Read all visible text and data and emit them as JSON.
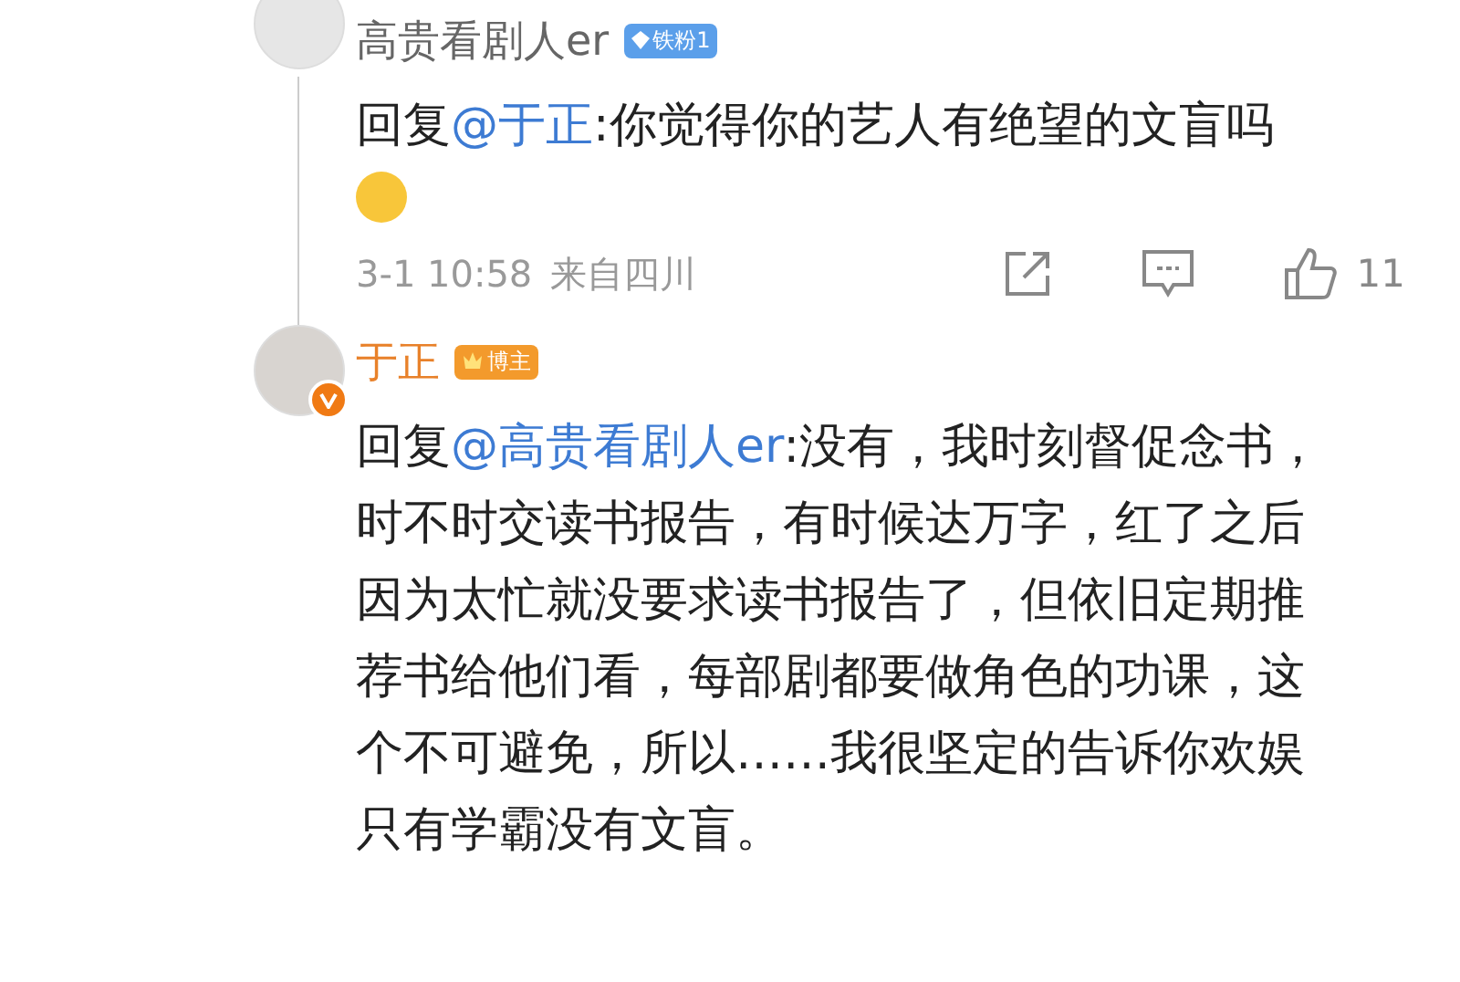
{
  "comments": [
    {
      "user": {
        "name": "高贵看剧人er",
        "verified": false,
        "badge": {
          "kind": "fan",
          "label": "铁粉1"
        }
      },
      "reply_prefix": "回复",
      "mention": "@于正",
      "text": ":你觉得你的艺人有绝望的文盲吗",
      "emoji": true,
      "meta": {
        "time": "3-1 10:58",
        "location": "来自四川",
        "likes": "11"
      }
    },
    {
      "user": {
        "name": "于正",
        "verified": true,
        "badge": {
          "kind": "author",
          "label": "博主"
        }
      },
      "reply_prefix": "回复",
      "mention": "@高贵看剧人er",
      "text": ":没有，我时刻督促念书，时不时交读书报告，有时候达万字，红了之后因为太忙就没要求读书报告了，但依旧定期推荐书给他们看，每部剧都要做角色的功课，这个不可避免，所以……我很坚定的告诉你欢娱只有学霸没有文盲。",
      "emoji": false
    }
  ]
}
